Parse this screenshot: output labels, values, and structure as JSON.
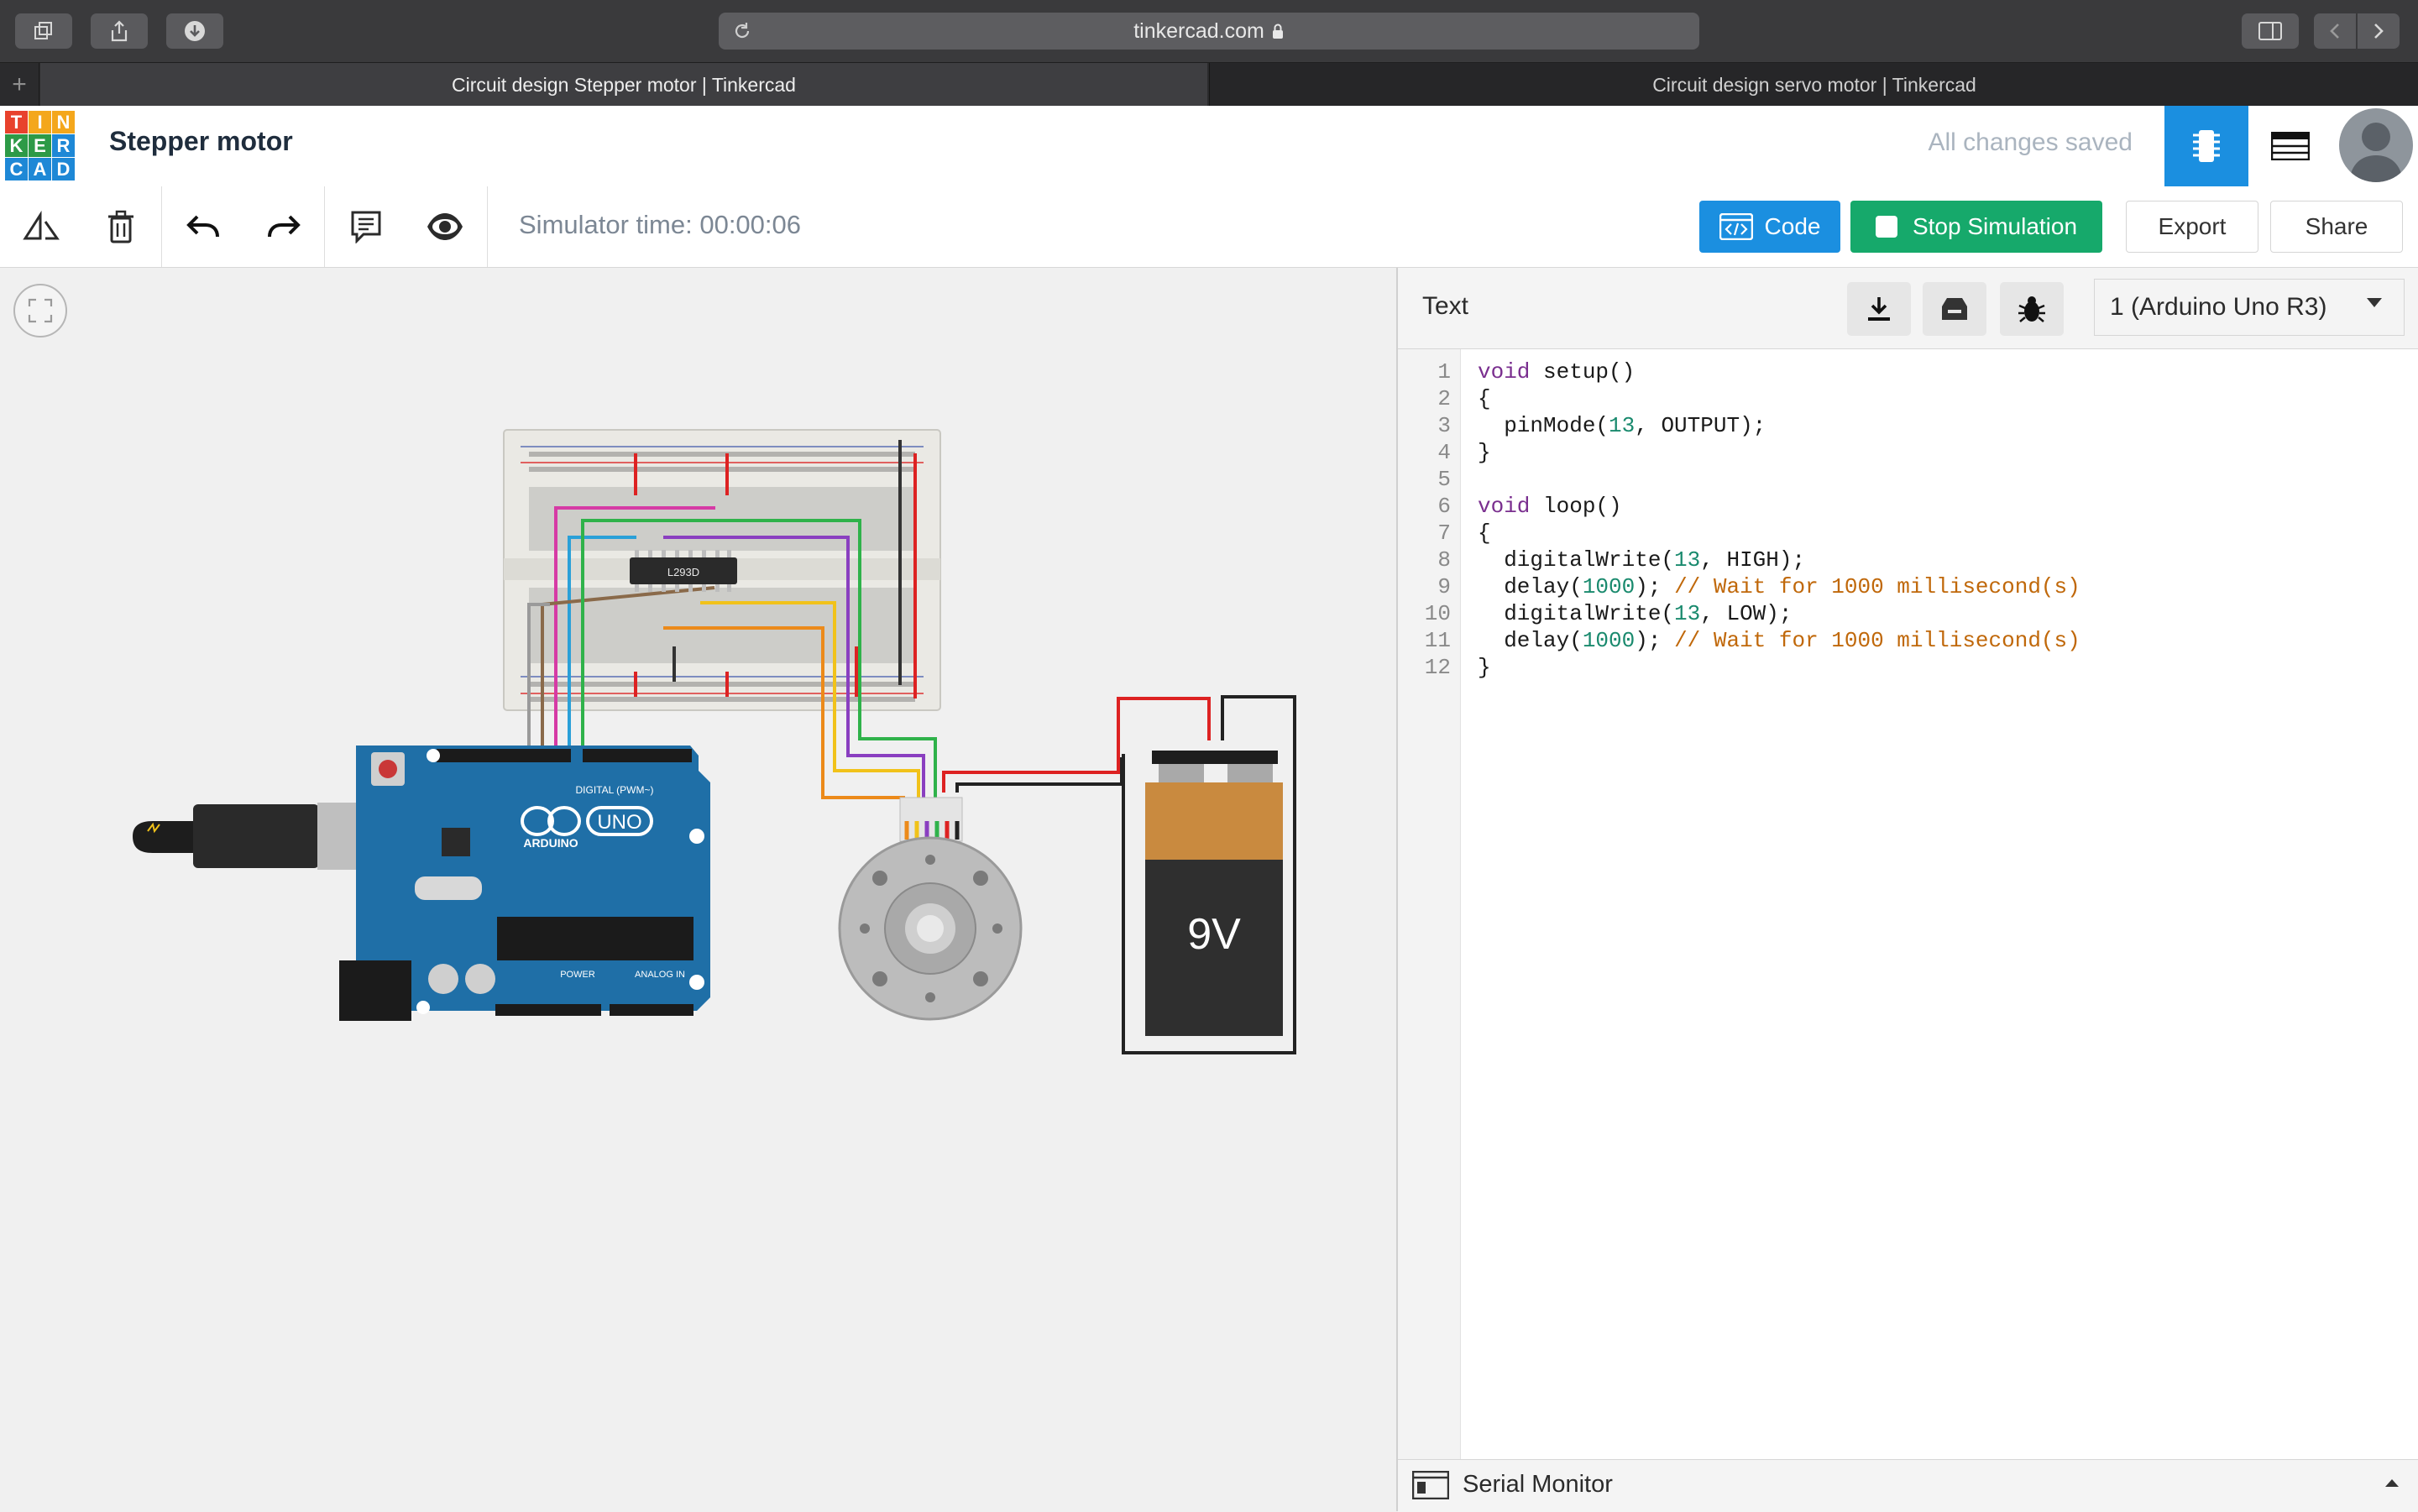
{
  "browser": {
    "url": "tinkercad.com",
    "tabs": [
      {
        "title": "Circuit design Stepper motor | Tinkercad"
      },
      {
        "title": "Circuit design servo motor | Tinkercad"
      }
    ]
  },
  "header": {
    "logo_letters": [
      "T",
      "I",
      "N",
      "K",
      "E",
      "R",
      "C",
      "A",
      "D"
    ],
    "title": "Stepper motor",
    "save_status": "All changes saved"
  },
  "toolbar": {
    "sim_time": "Simulator time: 00:00:06",
    "code_label": "Code",
    "stop_label": "Stop Simulation",
    "export_label": "Export",
    "share_label": "Share"
  },
  "circuit": {
    "ic_label": "L293D",
    "arduino_brand": "ARDUINO",
    "arduino_model": "UNO",
    "arduino_digital": "DIGITAL (PWM~)",
    "arduino_power": "POWER",
    "arduino_analog": "ANALOG IN",
    "battery_label": "9V"
  },
  "code_panel": {
    "mode": "Text",
    "board": "1 (Arduino Uno R3)",
    "lines": [
      {
        "n": "1",
        "html": "<span class=\"kw\">void</span> setup()"
      },
      {
        "n": "2",
        "html": "{"
      },
      {
        "n": "3",
        "html": "  pinMode(<span class=\"num\">13</span>, OUTPUT);"
      },
      {
        "n": "4",
        "html": "}"
      },
      {
        "n": "5",
        "html": ""
      },
      {
        "n": "6",
        "html": "<span class=\"kw\">void</span> loop()"
      },
      {
        "n": "7",
        "html": "{"
      },
      {
        "n": "8",
        "html": "  digitalWrite(<span class=\"num\">13</span>, HIGH);"
      },
      {
        "n": "9",
        "html": "  delay(<span class=\"num\">1000</span>); <span class=\"cm\">// Wait for 1000 millisecond(s)</span>"
      },
      {
        "n": "10",
        "html": "  digitalWrite(<span class=\"num\">13</span>, LOW);"
      },
      {
        "n": "11",
        "html": "  delay(<span class=\"num\">1000</span>); <span class=\"cm\">// Wait for 1000 millisecond(s)</span>"
      },
      {
        "n": "12",
        "html": "}"
      }
    ],
    "serial_monitor": "Serial Monitor"
  },
  "colors": {
    "accent_blue": "#1b8fe0",
    "stop_green": "#16a96b",
    "arduino_blue": "#1f6fa7"
  }
}
